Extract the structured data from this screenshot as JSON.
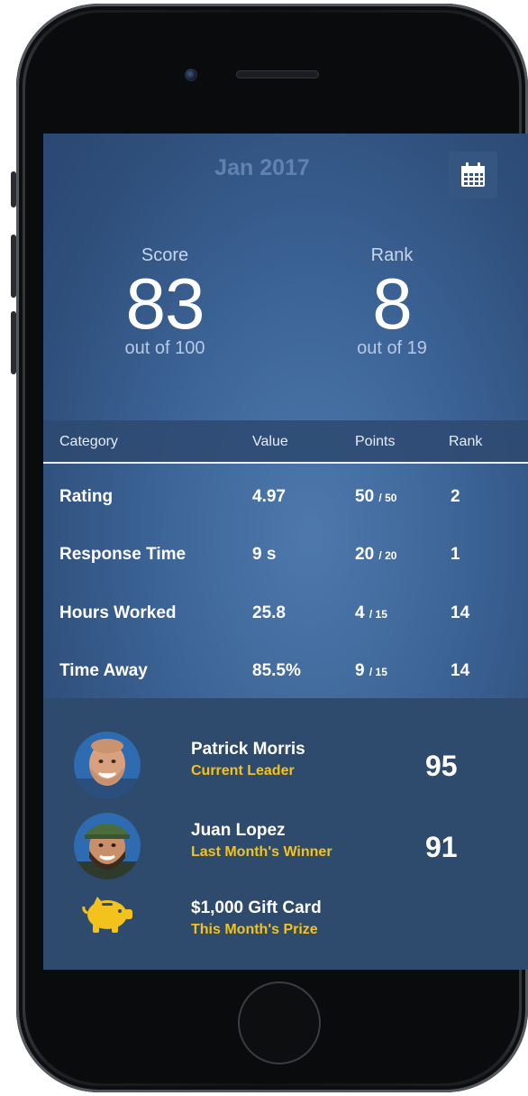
{
  "header": {
    "month": "Jan 2017",
    "calendar_icon": "calendar-icon"
  },
  "summary": {
    "score_label": "Score",
    "score_value": "83",
    "score_sub": "out of 100",
    "rank_label": "Rank",
    "rank_value": "8",
    "rank_sub": "out of 19"
  },
  "table": {
    "headers": [
      "Category",
      "Value",
      "Points",
      "Rank"
    ],
    "rows": [
      {
        "category": "Rating",
        "value": "4.97",
        "points": "50",
        "points_max": "/ 50",
        "rank": "2"
      },
      {
        "category": "Response Time",
        "value": "9 s",
        "points": "20",
        "points_max": "/ 20",
        "rank": "1"
      },
      {
        "category": "Hours Worked",
        "value": "25.8",
        "points": "4",
        "points_max": "/ 15",
        "rank": "14"
      },
      {
        "category": "Time Away",
        "value": "85.5%",
        "points": "9",
        "points_max": "/ 15",
        "rank": "14"
      }
    ]
  },
  "leaders": [
    {
      "name": "Patrick Morris",
      "subtitle": "Current Leader",
      "score": "95",
      "icon": "avatar-photo"
    },
    {
      "name": "Juan Lopez",
      "subtitle": "Last Month's Winner",
      "score": "91",
      "icon": "avatar-photo"
    },
    {
      "name": "$1,000 Gift Card",
      "subtitle": "This Month's Prize",
      "score": "",
      "icon": "piggy-bank-icon"
    }
  ],
  "colors": {
    "accent_yellow": "#f4c21c",
    "screen_blue": "#3c6497",
    "panel_blue": "#2e4a6d"
  }
}
